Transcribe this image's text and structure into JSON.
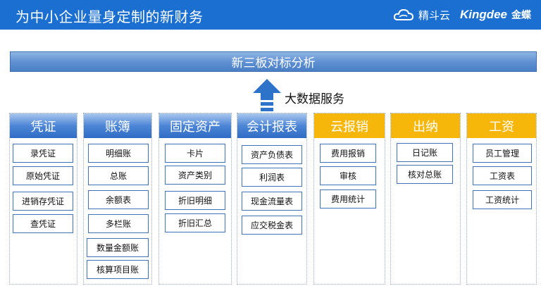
{
  "header": {
    "title": "为中小企业量身定制的新财务"
  },
  "brand": {
    "product": "精斗云",
    "company": "Kingdee",
    "company_cn": "金蝶"
  },
  "banner": {
    "label": "新三板对标分析"
  },
  "arrow": {
    "label": "大数据服务"
  },
  "columns": [
    {
      "title": "凭证",
      "items": [
        "录凭证",
        "原始凭证",
        "进销存凭证",
        "查凭证"
      ]
    },
    {
      "title": "账簿",
      "items": [
        "明细账",
        "总账",
        "余额表",
        "多栏账",
        "数量金额账",
        "核算项目账"
      ]
    },
    {
      "title": "固定资产",
      "items": [
        "卡片",
        "资产类别",
        "折旧明细",
        "折旧汇总"
      ]
    },
    {
      "title": "会计报表",
      "items": [
        "资产负债表",
        "利润表",
        "现金流量表",
        "应交税金表"
      ]
    },
    {
      "title": "云报销",
      "items": [
        "费用报销",
        "审核",
        "费用统计"
      ]
    },
    {
      "title": "出纳",
      "items": [
        "日记账",
        "核对总账"
      ]
    },
    {
      "title": "工资",
      "items": [
        "员工管理",
        "工资表",
        "工资统计"
      ]
    }
  ],
  "colors": {
    "header_bg": "#1a6fd0",
    "blue_head": "#2f6cc4",
    "yellow_head": "#f6b70a",
    "arrow": "#2d73c9"
  }
}
